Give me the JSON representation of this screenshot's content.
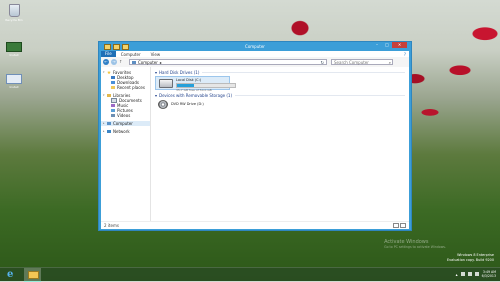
{
  "desktop": {
    "icons": [
      {
        "label": "Recycle Bin"
      },
      {
        "label": "Install"
      },
      {
        "label": "Install"
      }
    ]
  },
  "window": {
    "title": "Computer",
    "ribbon_tabs": [
      "File",
      "Computer",
      "View"
    ],
    "address": "Computer",
    "search_placeholder": "Search Computer",
    "nav": {
      "favorites": "Favorites",
      "desktop": "Desktop",
      "downloads": "Downloads",
      "recent": "Recent places",
      "libraries": "Libraries",
      "documents": "Documents",
      "music": "Music",
      "pictures": "Pictures",
      "videos": "Videos",
      "computer": "Computer",
      "network": "Network"
    },
    "sections": {
      "hdd": "Hard Disk Drives (1)",
      "removable": "Devices with Removable Storage (1)"
    },
    "drives": {
      "local": {
        "name": "Local Disk (C:)",
        "space": "35.7 GB free of 50.0 GB",
        "used_fraction": 0.29
      },
      "dvd": {
        "name": "DVD RW Drive (D:)"
      }
    },
    "status": "2 items"
  },
  "watermark": {
    "line1": "Activate Windows",
    "line2": "Go to PC settings to activate Windows."
  },
  "eval": {
    "line1": "Windows 8 Enterprise",
    "line2": "Evaluation copy. Build 9200"
  },
  "taskbar": {
    "time": "3:49 AM",
    "date": "6/3/2013"
  }
}
